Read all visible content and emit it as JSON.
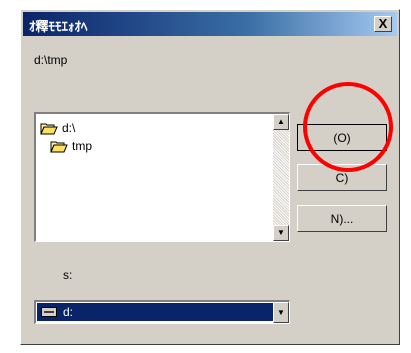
{
  "window": {
    "title": "ｵ釋ﾓﾓｴｫｵﾍ",
    "close_label": "X"
  },
  "path": "d:\\tmp",
  "folders": [
    {
      "label": "d:\\",
      "icon": "open-folder-icon"
    },
    {
      "label": "tmp",
      "icon": "open-folder-icon"
    }
  ],
  "buttons": {
    "ok": "(O)",
    "cancel": "C)",
    "network": "N)..."
  },
  "drive_label": "s:",
  "drive_value": "d:",
  "colors": {
    "titlebar": "#0a246a",
    "face": "#d4d0c8",
    "selection": "#0a246a",
    "annotation": "#ff0000"
  },
  "icons": {
    "scroll_up": "▲",
    "scroll_down": "▼",
    "combo_arrow": "▼"
  }
}
